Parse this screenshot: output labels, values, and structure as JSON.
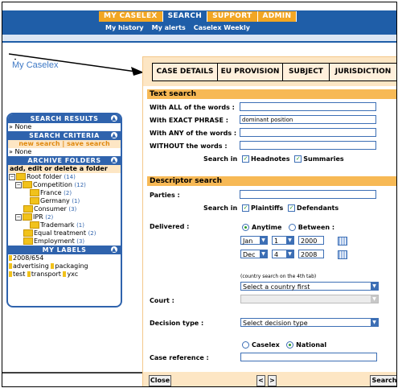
{
  "nav": {
    "tabs": [
      "MY CASELEX",
      "SEARCH",
      "SUPPORT",
      "ADMIN"
    ],
    "active_tab": "SEARCH",
    "sublinks": [
      "My history",
      "My alerts",
      "Caselex Weekly"
    ]
  },
  "page_title": "My Caselex",
  "left_panel": {
    "search_results": {
      "header": "SEARCH RESULTS",
      "value": "» None"
    },
    "search_criteria": {
      "header": "SEARCH CRITERIA",
      "link": "new search | save search",
      "value": "» None"
    },
    "archive_folders": {
      "header": "ARCHIVE FOLDERS",
      "link": "add, edit or delete a folder",
      "tree": [
        {
          "label": "Root folder",
          "count": "(14)",
          "level": 0,
          "expander": "-"
        },
        {
          "label": "Competition",
          "count": "(12)",
          "level": 1,
          "expander": "-"
        },
        {
          "label": "France",
          "count": "(2)",
          "level": 2,
          "expander": ""
        },
        {
          "label": "Germany",
          "count": "(1)",
          "level": 2,
          "expander": ""
        },
        {
          "label": "Consumer",
          "count": "(3)",
          "level": 1,
          "expander": ""
        },
        {
          "label": "IPR",
          "count": "(2)",
          "level": 1,
          "expander": "-"
        },
        {
          "label": "Trademark",
          "count": "(1)",
          "level": 2,
          "expander": ""
        },
        {
          "label": "Equal treatment",
          "count": "(2)",
          "level": 1,
          "expander": ""
        },
        {
          "label": "Employment",
          "count": "(3)",
          "level": 1,
          "expander": ""
        }
      ]
    },
    "my_labels": {
      "header": "MY LABELS",
      "labels": [
        "2008/654",
        "advertising",
        "packaging",
        "test",
        "transport",
        "yxc"
      ]
    }
  },
  "tabs": [
    "CASE DETAILS",
    "EU PROVISION",
    "SUBJECT",
    "JURISDICTION"
  ],
  "text_search": {
    "header": "Text search",
    "fields": [
      {
        "label": "With ALL of the words :",
        "value": ""
      },
      {
        "label": "With EXACT PHRASE :",
        "value": "dominant position"
      },
      {
        "label": "With ANY of the words :",
        "value": ""
      },
      {
        "label": "WITHOUT the words :",
        "value": ""
      }
    ],
    "search_in_label": "Search in",
    "options": [
      "Headnotes",
      "Summaries"
    ]
  },
  "descriptor_search": {
    "header": "Descriptor search",
    "parties_label": "Parties :",
    "parties_value": "",
    "search_in_label": "Search in",
    "party_options": [
      "Plaintiffs",
      "Defendants"
    ],
    "delivered_label": "Delivered :",
    "delivered_options": [
      "Anytime",
      "Between :"
    ],
    "delivered_selected": "Anytime",
    "from_date": {
      "month": "Jan",
      "day": "1",
      "year": "2000"
    },
    "to_date": {
      "month": "Dec",
      "day": "4",
      "year": "2008"
    },
    "country_hint": "(country search on the 4th tab)",
    "country_select": "Select a country first",
    "court_label": "Court :",
    "court_select": "",
    "decision_label": "Decision type :",
    "decision_select": "Select decision type",
    "source_options": [
      "Caselex",
      "National"
    ],
    "source_selected": "National",
    "case_ref_label": "Case reference :",
    "case_ref_value": ""
  },
  "footer": {
    "close": "Close",
    "prev": "<",
    "next": ">",
    "search": "Search"
  },
  "colors": {
    "blue": "#1f5ea8",
    "orange": "#f2a623",
    "section": "#f7b955",
    "panel_bg": "#fde6c4"
  }
}
